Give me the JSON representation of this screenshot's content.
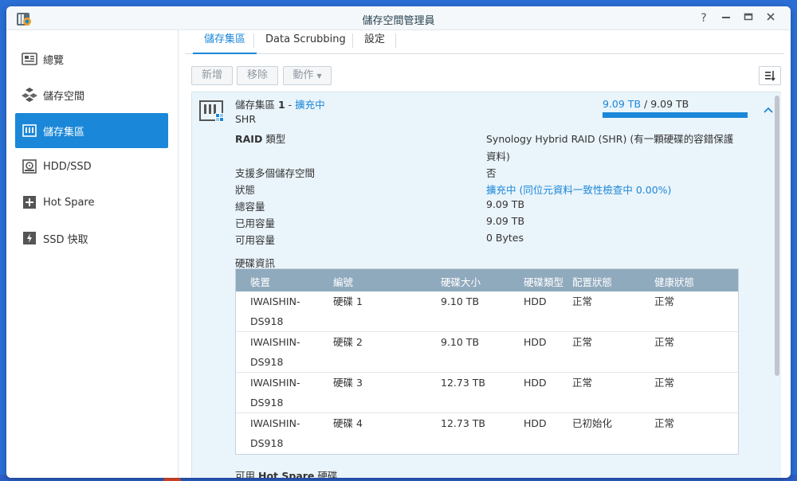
{
  "window": {
    "title": "儲存空間管理員",
    "help_icon": "help-icon",
    "minimize_icon": "minimize-icon",
    "maximize_icon": "maximize-icon",
    "close_icon": "close-icon"
  },
  "sidebar": {
    "items": [
      {
        "label": "總覽",
        "icon": "overview-icon"
      },
      {
        "label": "儲存空間",
        "icon": "volume-icon"
      },
      {
        "label": "儲存集區",
        "icon": "storage-pool-icon",
        "active": true
      },
      {
        "label": "HDD/SSD",
        "icon": "hdd-icon"
      },
      {
        "label": "Hot Spare",
        "icon": "hot-spare-icon"
      },
      {
        "label": "SSD 快取",
        "icon": "ssd-cache-icon"
      }
    ]
  },
  "tabs": [
    {
      "label": "儲存集區"
    },
    {
      "label": "Data Scrubbing"
    },
    {
      "label": "設定"
    }
  ],
  "toolbar": {
    "create_label": "新增",
    "remove_label": "移除",
    "action_label": "動作",
    "sort_icon": "sort-icon"
  },
  "pool": {
    "name": "儲存集區",
    "number": "1",
    "separator": " - ",
    "status_link": "擴充中",
    "type": "SHR",
    "used_text": "9.09 TB",
    "slash": " / ",
    "total_text": "9.09 TB",
    "usage_fraction": 1.0,
    "collapse_icon": "chevron-up-icon"
  },
  "details": {
    "raid_label_prefix": "RAID",
    "raid_label_suffix": " 類型",
    "raid_value_line1": "Synology Hybrid RAID (SHR) (有一顆硬碟的容錯保護",
    "raid_value_line2": "資料)",
    "multi_volume_label": "支援多個儲存空間",
    "multi_volume_value": "否",
    "status_label": "狀態",
    "status_value": "擴充中",
    "status_detail": "(同位元資料一致性檢查中 0.00%)",
    "total_label": "總容量",
    "total_value": "9.09 TB",
    "used_label": "已用容量",
    "used_value": "9.09 TB",
    "available_label": "可用容量",
    "available_value": "0 Bytes"
  },
  "disk_info": {
    "section_title": "硬碟資訊",
    "columns": [
      "裝置",
      "編號",
      "硬碟大小",
      "硬碟類型",
      "配置狀態",
      "健康狀態"
    ],
    "rows": [
      {
        "device1": "IWAISHIN-",
        "device2": "DS918",
        "id": "硬碟 1",
        "size": "9.10 TB",
        "type": "HDD",
        "alloc": "正常",
        "health": "正常"
      },
      {
        "device1": "IWAISHIN-",
        "device2": "DS918",
        "id": "硬碟 2",
        "size": "9.10 TB",
        "type": "HDD",
        "alloc": "正常",
        "health": "正常"
      },
      {
        "device1": "IWAISHIN-",
        "device2": "DS918",
        "id": "硬碟 3",
        "size": "12.73 TB",
        "type": "HDD",
        "alloc": "正常",
        "health": "正常"
      },
      {
        "device1": "IWAISHIN-",
        "device2": "DS918",
        "id": "硬碟 4",
        "size": "12.73 TB",
        "type": "HDD",
        "alloc": "已初始化",
        "health": "正常"
      }
    ]
  },
  "hot_spare": {
    "prefix": "可用",
    "bold": "Hot Spare",
    "suffix": " 硬碟"
  },
  "colors": {
    "accent": "#1b87d8",
    "healthy": "#31a33a",
    "table_header": "#8fa9bd",
    "panel_bg": "#eaf4fb"
  }
}
